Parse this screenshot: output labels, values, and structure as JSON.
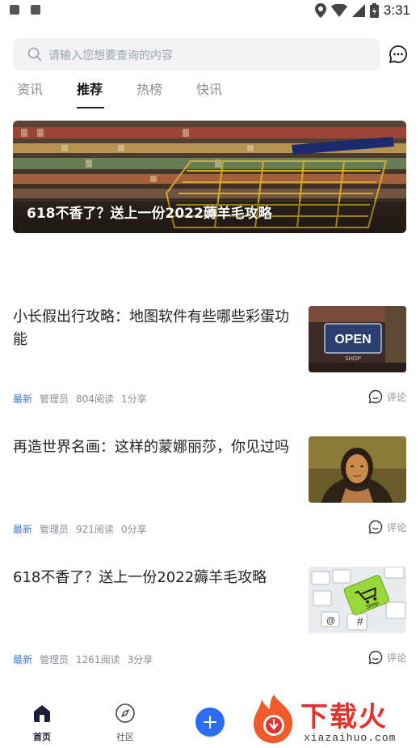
{
  "status_bar": {
    "time": "3:31"
  },
  "search": {
    "placeholder": "请输入您想要查询的内容"
  },
  "tabs": [
    {
      "label": "资讯",
      "active": false
    },
    {
      "label": "推荐",
      "active": true
    },
    {
      "label": "热榜",
      "active": false
    },
    {
      "label": "快讯",
      "active": false
    }
  ],
  "banner": {
    "title": "618不香了？送上一份2022薅羊毛攻略"
  },
  "articles": [
    {
      "title": "小长假出行攻略：地图软件有些哪些彩蛋功能",
      "tag": "最新",
      "author": "管理员",
      "reads": "804阅读",
      "shares": "1分享",
      "comment": "评论",
      "thumb": "open-sign"
    },
    {
      "title": "再造世界名画：这样的蒙娜丽莎，你见过吗",
      "tag": "最新",
      "author": "管理员",
      "reads": "921阅读",
      "shares": "0分享",
      "comment": "评论",
      "thumb": "mona-lisa"
    },
    {
      "title": "618不香了？送上一份2022薅羊毛攻略",
      "tag": "最新",
      "author": "管理员",
      "reads": "1261阅读",
      "shares": "3分享",
      "comment": "评论",
      "thumb": "shop-keyboard"
    }
  ],
  "bottom_nav": [
    {
      "label": "首页",
      "icon": "home-icon",
      "active": true
    },
    {
      "label": "社区",
      "icon": "compass-icon",
      "active": false
    }
  ],
  "watermark": {
    "brand": "下载火",
    "domain": "xiazaihuo.com"
  },
  "colors": {
    "accent": "#2b6df2",
    "tag_blue": "#3f7bd8",
    "brand_red": "#e2322b"
  }
}
